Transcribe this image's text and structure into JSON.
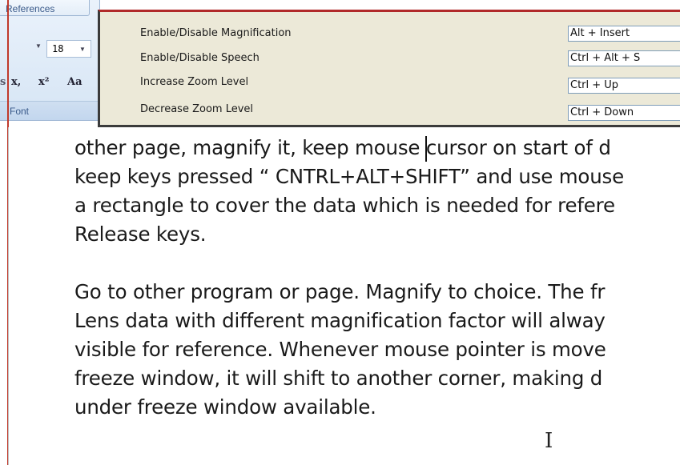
{
  "ribbon": {
    "tab_label": "References",
    "font_size": "18",
    "format_buttons": [
      "x,",
      "x²",
      "Aa"
    ],
    "group_label": "Font"
  },
  "dialog": {
    "rows": [
      {
        "label": "Enable/Disable Magnification",
        "key": "Alt + Insert"
      },
      {
        "label": "Enable/Disable Speech",
        "key": "Ctrl + Alt + S"
      },
      {
        "label": "Increase Zoom Level",
        "key": "Ctrl + Up"
      },
      {
        "label": "Decrease Zoom Level",
        "key": "Ctrl + Down"
      }
    ]
  },
  "document": {
    "paragraph1": [
      "other page, magnify it, keep mouse cursor on start of d",
      "keep keys pressed “ CNTRL+ALT+SHIFT” and use mouse",
      "a rectangle to cover the data which is needed for refere",
      "Release keys."
    ],
    "paragraph2": [
      "Go to other program or page. Magnify to choice. The fr",
      "Lens data with different magnification factor will alway",
      "visible for reference. Whenever mouse pointer is move",
      "freeze window, it will shift to another corner, making d",
      "under freeze window available."
    ]
  },
  "colors": {
    "dialog_bg": "#ece9d8",
    "ribbon_bg": "#d6e5f5",
    "margin_line": "#c0392b"
  }
}
